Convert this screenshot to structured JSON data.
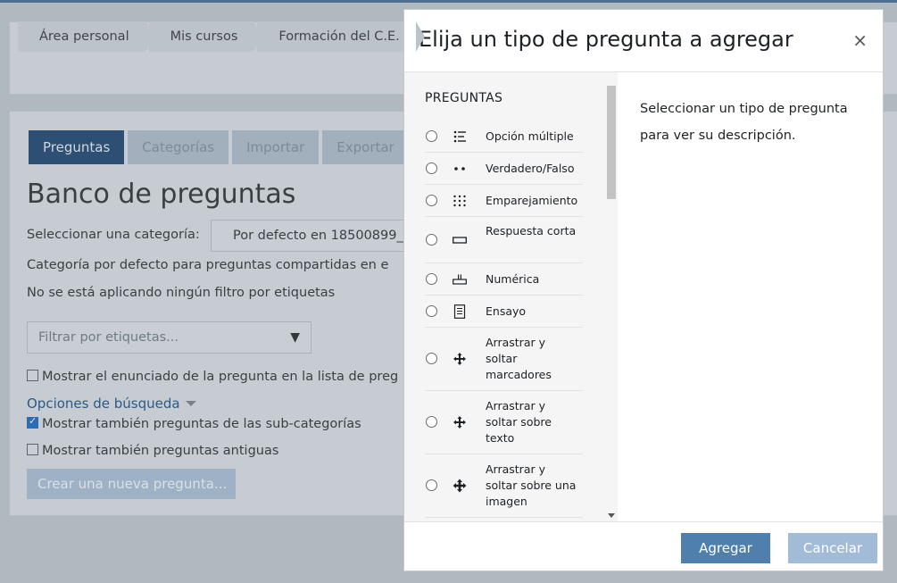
{
  "breadcrumb": [
    "Área personal",
    "Mis cursos",
    "Formación del C.E."
  ],
  "tabs": [
    "Preguntas",
    "Categorías",
    "Importar",
    "Exportar"
  ],
  "page": {
    "title": "Banco de preguntas",
    "select_category_label": "Seleccionar una categoría:",
    "select_category_value": "Por defecto en 18500899_",
    "default_category_text": "Categoría por defecto para preguntas compartidas en e",
    "no_filter_text": "No se está aplicando ningún filtro por etiquetas",
    "tag_filter_placeholder": "Filtrar por etiquetas...",
    "show_statement_label": "Mostrar el enunciado de la pregunta en la lista de preg",
    "search_options_label": "Opciones de búsqueda",
    "show_subcategories_label": "Mostrar también preguntas de las sub-categorías",
    "show_old_label": "Mostrar también preguntas antiguas",
    "new_question_button": "Crear una nueva pregunta..."
  },
  "modal": {
    "title": "Elija un tipo de pregunta a agregar",
    "close": "×",
    "section_title": "PREGUNTAS",
    "description": "Seleccionar un tipo de pregunta para ver su descripción.",
    "add_button": "Agregar",
    "cancel_button": "Cancelar",
    "question_types": [
      {
        "label": "Opción múltiple",
        "icon": "multichoice-icon"
      },
      {
        "label": "Verdadero/Falso",
        "icon": "truefalse-icon"
      },
      {
        "label": "Emparejamiento",
        "icon": "match-icon"
      },
      {
        "label": "Respuesta corta",
        "icon": "shortanswer-icon"
      },
      {
        "label": "Numérica",
        "icon": "numerical-icon"
      },
      {
        "label": "Ensayo",
        "icon": "essay-icon"
      },
      {
        "label": "Arrastrar y soltar marcadores",
        "icon": "ddmarker-icon"
      },
      {
        "label": "Arrastrar y soltar sobre texto",
        "icon": "ddwtos-icon"
      },
      {
        "label": "Arrastrar y soltar sobre una imagen",
        "icon": "ddimageortext-icon"
      }
    ]
  }
}
